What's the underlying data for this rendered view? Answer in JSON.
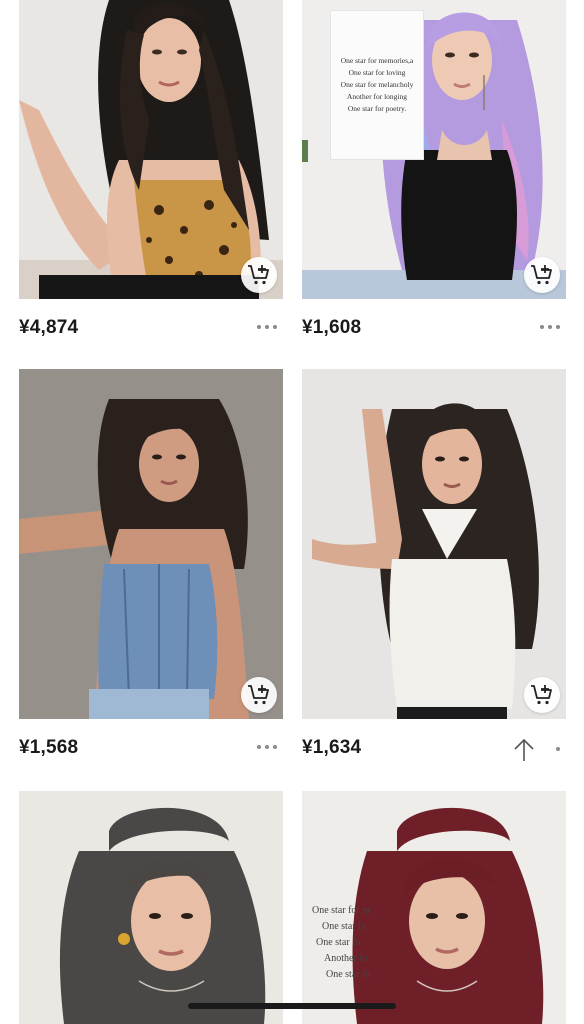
{
  "products": [
    {
      "price": "¥4,874",
      "more_icon": "more-dots-icon",
      "cart_icon": "add-to-cart-icon"
    },
    {
      "price": "¥1,608",
      "more_icon": "more-dots-icon",
      "cart_icon": "add-to-cart-icon",
      "poster_lines": [
        "One star for memories,a",
        "One star for loving",
        "One star for melancholy",
        "Another for longing",
        "One star for poetry."
      ]
    },
    {
      "price": "¥1,568",
      "more_icon": "more-dots-icon",
      "cart_icon": "add-to-cart-icon"
    },
    {
      "price": "¥1,634",
      "more_icon": "scroll-up-arrow-icon",
      "cart_icon": "add-to-cart-icon"
    },
    {
      "price": "",
      "cart_icon": "add-to-cart-icon"
    },
    {
      "price": "",
      "poster_lines": [
        "One star for m",
        "One star fo",
        "One star fo",
        "Another fo",
        "One star fo"
      ]
    }
  ],
  "colors": {
    "price_text": "#1a1a1a",
    "icon_gray": "#8a8a8a",
    "background": "#ffffff"
  }
}
